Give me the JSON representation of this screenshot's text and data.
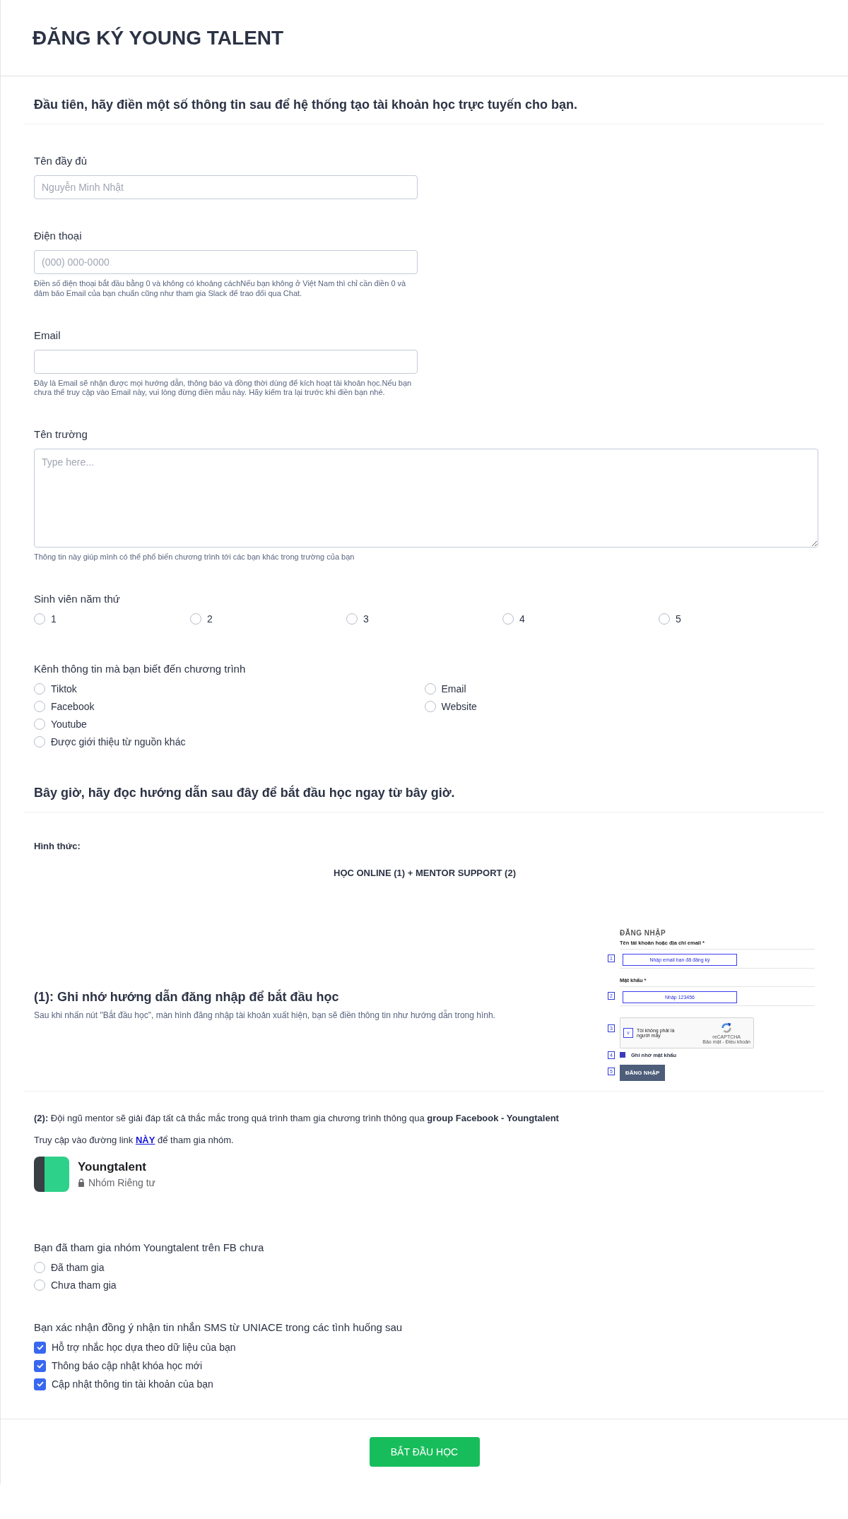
{
  "header": {
    "title": "ĐĂNG KÝ YOUNG TALENT"
  },
  "form": [
    {
      "kind": "heading",
      "text": "Đầu tiên, hãy điền một số thông tin sau để hệ thống tạo tài khoản học trực tuyến cho bạn."
    },
    {
      "kind": "input",
      "label": "Tên đầy đủ",
      "placeholder": "Nguyễn Minh Nhật"
    },
    {
      "kind": "input",
      "label": "Điện thoại",
      "placeholder": "(000) 000-0000",
      "hint": "Điền số điện thoại bắt đầu bằng 0 và không có khoảng cáchNếu bạn không ở Việt Nam thì chỉ cần điền 0 và đảm bảo Email của bạn chuẩn cũng như tham gia Slack để trao đổi qua Chat."
    },
    {
      "kind": "input",
      "label": "Email",
      "hint": "Đây là Email sẽ nhận được mọi hướng dẫn, thông báo và đồng thời dùng để kích hoạt tài khoản học.Nếu bạn chưa thể truy cập vào Email này, vui lòng đừng điền mẫu này. Hãy kiểm tra lại trước khi điền bạn nhé."
    },
    {
      "kind": "textarea",
      "label": "Tên trường",
      "placeholder": "Type here...",
      "hint": "Thông tin này giúp mình có thể phổ biến chương trình tới các bạn khác trong trường của bạn"
    },
    {
      "kind": "radio_row",
      "label": "Sinh viên năm thứ",
      "options": [
        {
          "label": "1",
          "selected": false
        },
        {
          "label": "2",
          "selected": false
        },
        {
          "label": "3",
          "selected": false
        },
        {
          "label": "4",
          "selected": false
        },
        {
          "label": "5",
          "selected": false
        }
      ]
    },
    {
      "kind": "radio_columns",
      "label": "Kênh thông tin mà bạn biết đến chương trình",
      "columns": [
        [
          {
            "label": "Tiktok",
            "selected": false
          },
          {
            "label": "Facebook",
            "selected": false
          },
          {
            "label": "Youtube",
            "selected": false
          },
          {
            "label": "Được giới thiệu từ nguồn khác",
            "selected": false
          }
        ],
        [
          {
            "label": "Email",
            "selected": false
          },
          {
            "label": "Website",
            "selected": false
          }
        ]
      ]
    },
    {
      "kind": "heading",
      "text": "Bây giờ, hãy đọc hướng dẫn sau đây để bắt đầu học ngay từ bây giờ."
    },
    {
      "kind": "format",
      "label": "Hình thức:",
      "value": "HỌC ONLINE (1) + MENTOR SUPPORT (2)"
    },
    {
      "kind": "login_guide",
      "title": "(1): Ghi nhớ hướng dẫn đăng nhập để bắt đầu học",
      "description": "Sau khi nhấn nút \"Bắt đầu học\", màn hình đăng nhập tài khoản xuất hiện, bạn sẽ điền thông tin như hướng dẫn trong hình.",
      "screenshot": {
        "title": "ĐĂNG NHẬP",
        "username_label": "Tên tài khoản hoặc địa chỉ email *",
        "username_hint": "Nhập email bạn đã đăng ký",
        "password_label": "Mật khẩu *",
        "password_hint": "Nhập 123456",
        "captcha_mark": "v",
        "captcha_checked": true,
        "remember_checked": true,
        "captcha_text": "Tôi không phải là người máy",
        "captcha_brand": "reCAPTCHA",
        "captcha_links": "Bảo mật - Điều khoản",
        "remember": "Ghi nhớ mật khẩu",
        "button": "ĐĂNG NHẬP",
        "steps": [
          "1",
          "2",
          "3",
          "4",
          "5"
        ]
      }
    },
    {
      "kind": "mentor",
      "text": "**(2):** Đội ngũ mentor sẽ giải đáp tất cả thắc mắc trong quá trình tham gia chương trình thông qua **group Facebook - Youngtalent**",
      "link_before": "Truy cập vào đường link ",
      "link": "NÀY",
      "link_after": " để tham gia nhóm.",
      "group": {
        "name": "Youngtalent",
        "privacy": "Nhóm Riêng tư"
      }
    },
    {
      "kind": "radio_list",
      "label": "Bạn đã tham gia nhóm Youngtalent trên FB chưa",
      "options": [
        {
          "label": "Đã tham gia",
          "selected": false
        },
        {
          "label": "Chưa tham gia",
          "selected": false
        }
      ]
    },
    {
      "kind": "checkbox_list",
      "label": "Bạn xác nhận đồng ý nhận tin nhắn SMS từ UNIACE trong các tình huống sau",
      "options": [
        {
          "label": "Hỗ trợ nhắc học dựa theo dữ liệu của bạn",
          "checked": true
        },
        {
          "label": "Thông báo cập nhật khóa học mới",
          "checked": true
        },
        {
          "label": "Cập nhật thông tin tài khoản của bạn",
          "checked": true
        }
      ]
    }
  ],
  "footer": {
    "button": "BẮT ĐẦU HỌC"
  }
}
